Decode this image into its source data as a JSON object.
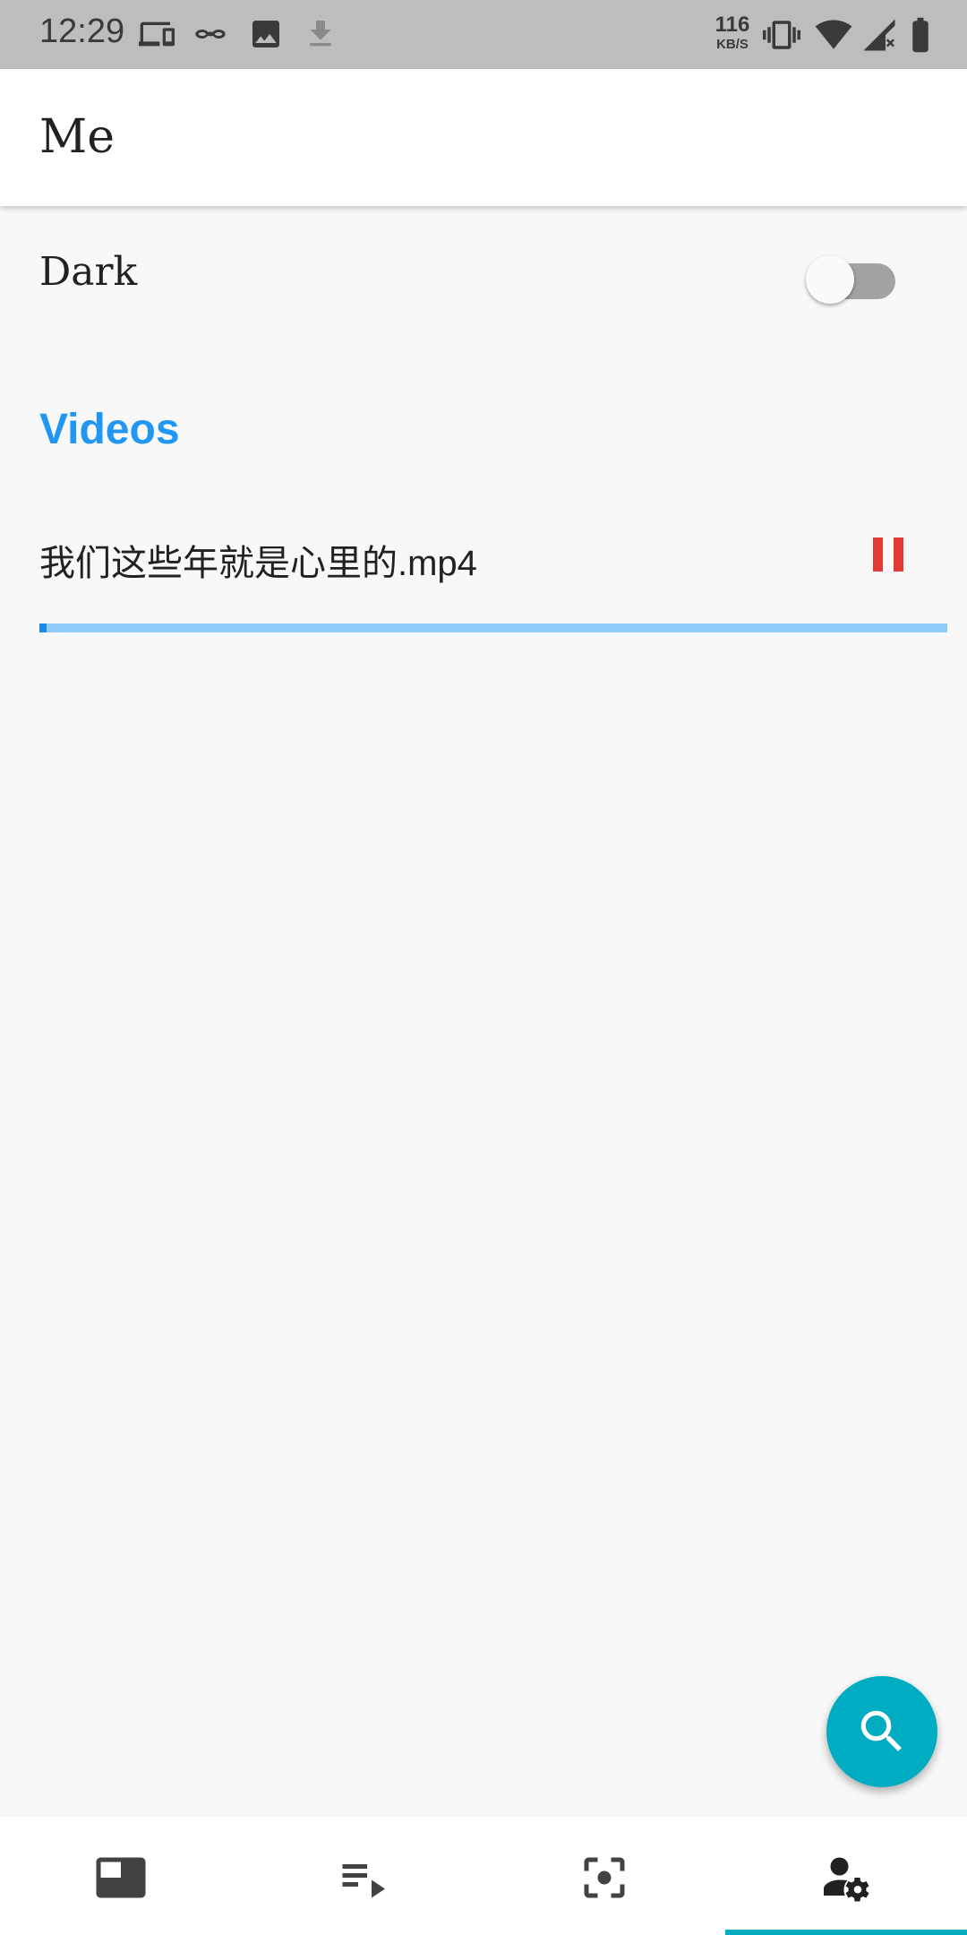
{
  "status_bar": {
    "time": "12:29",
    "net_speed_value": "116",
    "net_speed_unit": "KB/S",
    "left_icons": [
      "devices-icon",
      "incognito-icon",
      "image-icon",
      "download-icon"
    ],
    "right_icons": [
      "vibrate-icon",
      "wifi-icon",
      "signal-no-data-icon",
      "battery-icon"
    ]
  },
  "app_bar": {
    "title": "Me"
  },
  "settings": {
    "dark_label": "Dark",
    "dark_enabled": false
  },
  "videos": {
    "section_title": "Videos",
    "items": [
      {
        "name": "我们这些年就是心里的.mp4",
        "action_icon": "pause-icon",
        "progress_fraction": 0.008
      }
    ]
  },
  "fab": {
    "icon": "search-icon"
  },
  "bottom_nav": {
    "items": [
      {
        "icon": "featured-video-icon",
        "selected": false
      },
      {
        "icon": "playlist-play-icon",
        "selected": false
      },
      {
        "icon": "center-focus-icon",
        "selected": false
      },
      {
        "icon": "account-settings-icon",
        "selected": true
      }
    ]
  },
  "colors": {
    "accent": "#2196f3",
    "fab": "#00acc1",
    "pause": "#e53935",
    "progress_track": "#90caf9",
    "status_bar": "#bdbdbd"
  }
}
